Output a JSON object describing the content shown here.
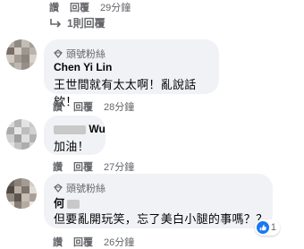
{
  "top_actions": {
    "like": "讚",
    "reply": "回覆",
    "time": "29分鐘"
  },
  "replies_link": {
    "label": "1則回覆"
  },
  "comments": [
    {
      "badge": "頭號粉絲",
      "name": "Chen Yi Lin",
      "text": "王世間就有太太啊！亂說話欸！",
      "like": "讚",
      "reply": "回覆",
      "time": "28分鐘"
    },
    {
      "badge": "",
      "name": "Wu",
      "text": "加油！",
      "like": "讚",
      "reply": "回覆",
      "time": "27分鐘"
    },
    {
      "badge": "頭號粉絲",
      "name": "何",
      "text": "但要亂開玩笑，忘了美白小腿的事嗎？？",
      "like": "讚",
      "reply": "回覆",
      "time": "26分鐘",
      "reaction_count": "1"
    }
  ],
  "colors": {
    "bubble": "#f0f2f5",
    "meta": "#65676b",
    "like_blue": "#1877f2"
  }
}
